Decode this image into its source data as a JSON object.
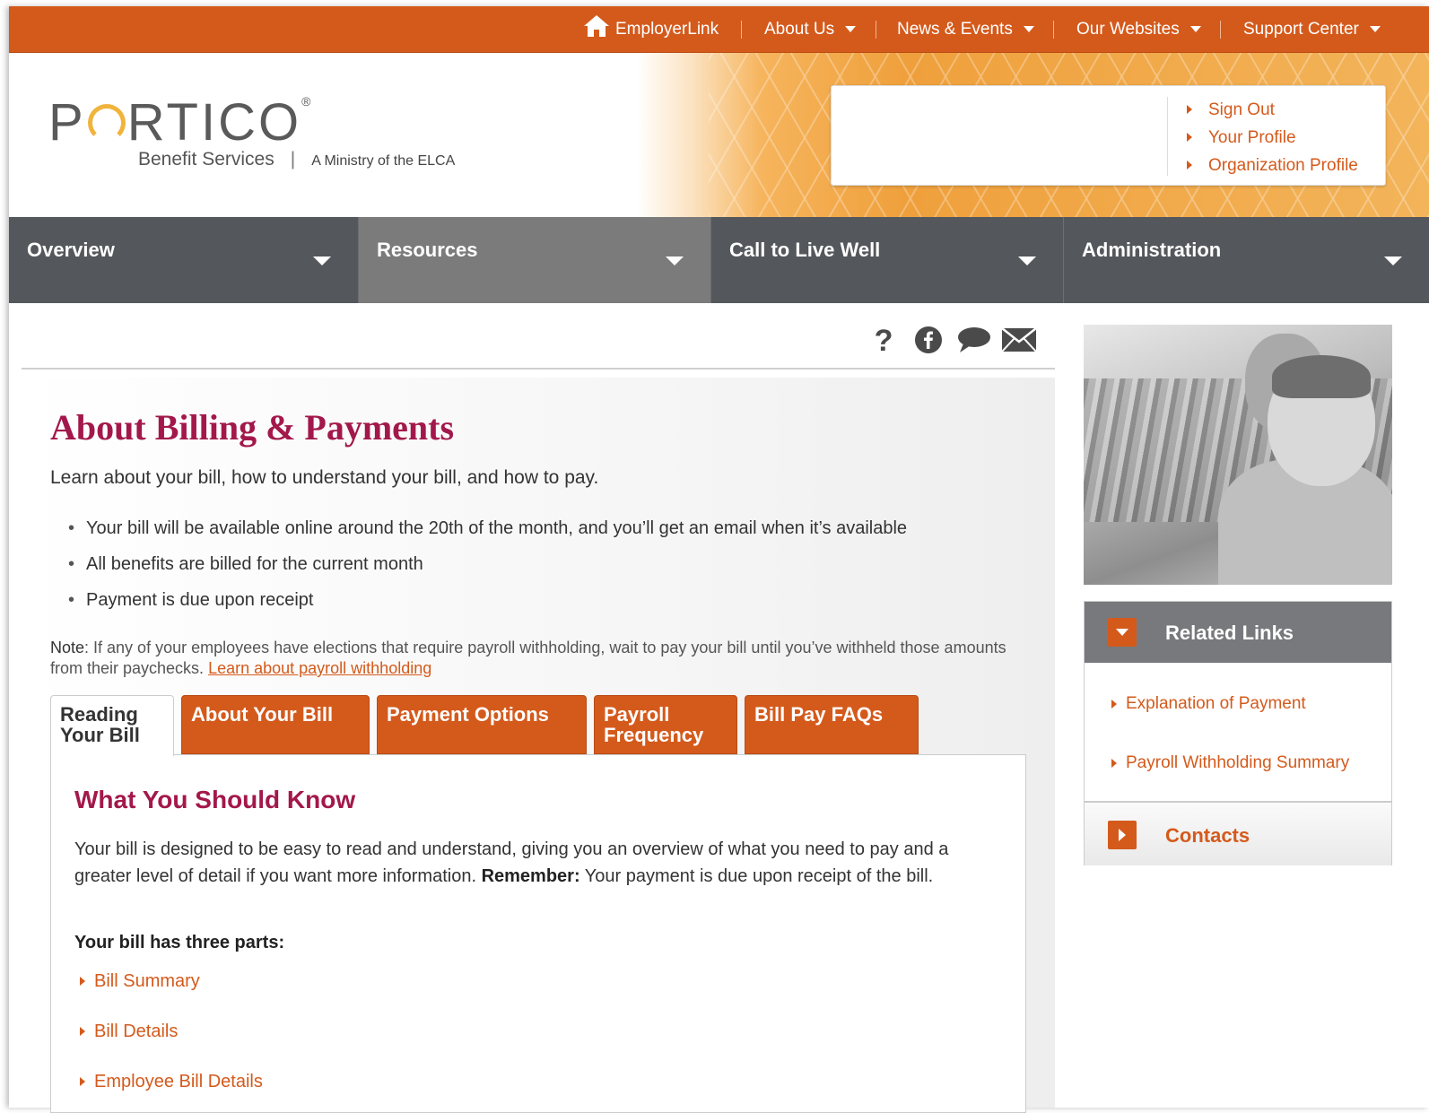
{
  "topbar": {
    "home_label": "EmployerLink",
    "items": [
      {
        "label": "About Us"
      },
      {
        "label": "News & Events"
      },
      {
        "label": "Our Websites"
      },
      {
        "label": "Support Center"
      }
    ]
  },
  "header": {
    "logo_text_pre": "P",
    "logo_text_post": "RTICO",
    "logo_reg": "®",
    "logo_sub": "Benefit Services",
    "logo_ministry": "A Ministry of the ELCA",
    "account_links": [
      "Sign Out",
      "Your Profile",
      "Organization Profile"
    ]
  },
  "mainnav": [
    {
      "label": "Overview"
    },
    {
      "label": "Resources"
    },
    {
      "label": "Call to Live Well"
    },
    {
      "label": "Administration"
    }
  ],
  "icons": [
    "help-icon",
    "facebook-icon",
    "chat-icon",
    "email-icon"
  ],
  "content": {
    "title": "About Billing & Payments",
    "intro": "Learn about your bill, how to understand your bill, and how to pay.",
    "bullets": [
      "Your bill will be available online around the 20th of the month, and you’ll get an email when it’s available",
      "All benefits are billed for the current month",
      "Payment is due upon receipt"
    ],
    "note_label": "Note",
    "note_text": ": If any of your employees have elections that require payroll withholding, wait to pay your bill until you’ve withheld those amounts from their paychecks. ",
    "note_link": "Learn about payroll withholding"
  },
  "tabs": [
    {
      "label": "Reading Your Bill"
    },
    {
      "label": "About Your Bill"
    },
    {
      "label": "Payment Options"
    },
    {
      "label": "Payroll Frequency"
    },
    {
      "label": "Bill Pay FAQs"
    }
  ],
  "panel": {
    "heading": "What You Should Know",
    "p_before": "Your bill is designed to be easy to read and understand, giving you an overview of what you need to pay and a greater level of detail if you want more information. ",
    "p_bold": "Remember:",
    "p_after": " Your payment is due upon receipt of the bill.",
    "parts_heading": "Your bill has three parts:",
    "parts": [
      "Bill Summary",
      "Bill Details",
      "Employee Bill Details"
    ]
  },
  "sidebar": {
    "related_title": "Related Links",
    "related_links": [
      "Explanation of Payment",
      "Payroll Withholding Summary"
    ],
    "contacts_title": "Contacts"
  },
  "colors": {
    "accent": "#d45a1c",
    "heading": "#a3184b",
    "nav": "#54575b"
  }
}
